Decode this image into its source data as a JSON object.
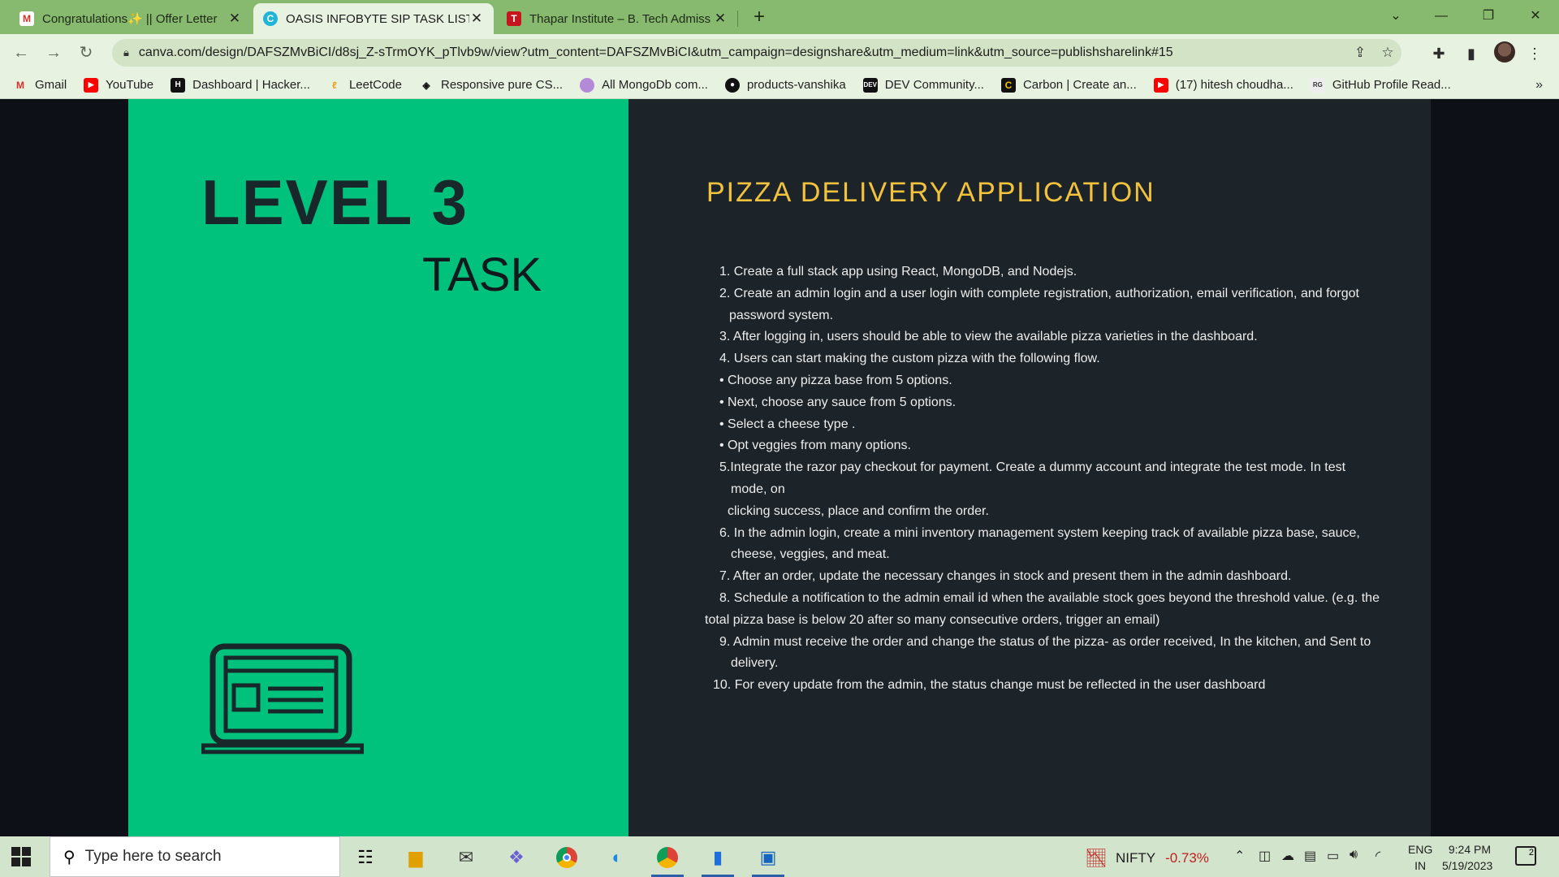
{
  "browser": {
    "tabs": [
      {
        "title": "Congratulations✨ || Offer Letter",
        "icon": "gmail-icon"
      },
      {
        "title": "OASIS INFOBYTE SIP TASK LIST",
        "icon": "canva-icon"
      },
      {
        "title": "Thapar Institute – B. Tech Admiss",
        "icon": "thapar-icon"
      }
    ],
    "url": "canva.com/design/DAFSZMvBiCI/d8sj_Z-sTrmOYK_pTlvb9w/view?utm_content=DAFSZMvBiCI&utm_campaign=designshare&utm_medium=link&utm_source=publishsharelink#15",
    "bookmarks": [
      {
        "label": "Gmail",
        "icon": "gmail-icon"
      },
      {
        "label": "YouTube",
        "icon": "youtube-icon"
      },
      {
        "label": "Dashboard | Hacker...",
        "icon": "hackerrank-icon"
      },
      {
        "label": "LeetCode",
        "icon": "leetcode-icon"
      },
      {
        "label": "Responsive pure CS...",
        "icon": "codepen-icon"
      },
      {
        "label": "All MongoDb com...",
        "icon": "avatar-icon"
      },
      {
        "label": "products-vanshika",
        "icon": "github-icon"
      },
      {
        "label": "DEV Community...",
        "icon": "dev-icon"
      },
      {
        "label": "Carbon | Create an...",
        "icon": "carbon-icon"
      },
      {
        "label": "(17) hitesh choudha...",
        "icon": "youtube-icon"
      },
      {
        "label": "GitHub Profile Read...",
        "icon": "github-readme-icon"
      }
    ]
  },
  "slide": {
    "level": "LEVEL 3",
    "task": "TASK",
    "headline": "PIZZA DELIVERY APPLICATION",
    "items": [
      "1.  Create a full stack app using React, MongoDB, and Nodejs.",
      "2. Create an admin login and a user login with complete registration, authorization, email verification, and forgot",
      "password system.",
      "3. After logging in, users should be able to view the available pizza varieties in the dashboard.",
      "4. Users can start making the custom pizza with the following flow.",
      "•  Choose any pizza base from 5 options.",
      "•  Next, choose any sauce from 5 options.",
      "•  Select a cheese type .",
      "•  Opt veggies from many options.",
      "5.Integrate the razor pay checkout for payment. Create a dummy account and integrate the test mode. In test",
      "mode, on",
      "clicking success, place and confirm the order.",
      "6. In the admin login, create a mini inventory management system keeping track of available pizza base, sauce,",
      "cheese, veggies, and meat.",
      "7. After an order, update the necessary changes in stock and present them in the admin dashboard.",
      "8. Schedule a notification to the admin email id when the available stock goes beyond the threshold value. (e.g. the",
      "total  pizza base is below 20 after so many consecutive orders, trigger an email)",
      "9. Admin must receive the order and change the status of the pizza- as order received, In the kitchen, and Sent to",
      "delivery.",
      "10. For every update from the admin, the status change must be reflected in the user dashboard"
    ]
  },
  "taskbar": {
    "search_placeholder": "Type here to search",
    "ticker_name": "NIFTY",
    "ticker_change": "-0.73%",
    "lang_1": "ENG",
    "lang_2": "IN",
    "time": "9:24 PM",
    "date": "5/19/2023",
    "notification_count": "2"
  }
}
